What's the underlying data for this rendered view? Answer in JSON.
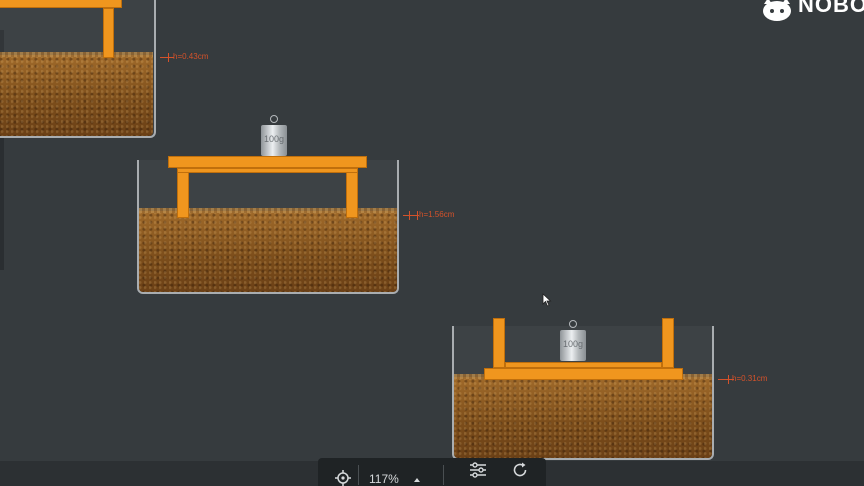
{
  "brand": {
    "text": "NOBO",
    "icon": "cat-face-logo-icon"
  },
  "experiments": [
    {
      "name": "experiment-1-table-upright-no-weight",
      "depth_label": "h=0.43cm"
    },
    {
      "name": "experiment-2-table-upright-with-weight",
      "weight_label": "100g",
      "depth_label": "h=1.56cm"
    },
    {
      "name": "experiment-3-table-inverted-with-weight",
      "weight_label": "100g",
      "depth_label": "h=0.31cm"
    }
  ],
  "toolbar": {
    "locate_icon": "crosshair-icon",
    "zoom": "117%",
    "zoom_caret_icon": "caret-up-icon",
    "settings_icon": "sliders-icon",
    "reset_icon": "refresh-icon"
  },
  "colors": {
    "background": "#363b3e",
    "wood": "#f0961e",
    "sand": "#8a5a22",
    "glass": "#a9adb0",
    "measure": "#d4522a",
    "toolbar": "#1f2325"
  }
}
